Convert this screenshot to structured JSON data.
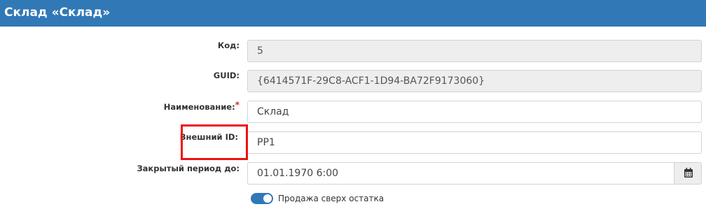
{
  "header": {
    "title": "Склад «Склад»"
  },
  "form": {
    "code": {
      "label": "Код:",
      "value": "5"
    },
    "guid": {
      "label": "GUID:",
      "value": "{6414571F-29C8-ACF1-1D94-BA72F9173060}"
    },
    "name": {
      "label": "Наименование:",
      "required_mark": "*",
      "value": "Склад"
    },
    "external_id": {
      "label": "Внешний ID:",
      "value": "PP1"
    },
    "closed_period": {
      "label": "Закрытый период до:",
      "value": "01.01.1970 6:00",
      "button_icon": "calendar-icon"
    },
    "oversell": {
      "label": "Продажа сверх остатка",
      "checked": true
    }
  },
  "colors": {
    "header_bg": "#3178b6",
    "toggle_on": "#3178b6",
    "required": "#d0312d",
    "highlight": "#ee1111"
  }
}
